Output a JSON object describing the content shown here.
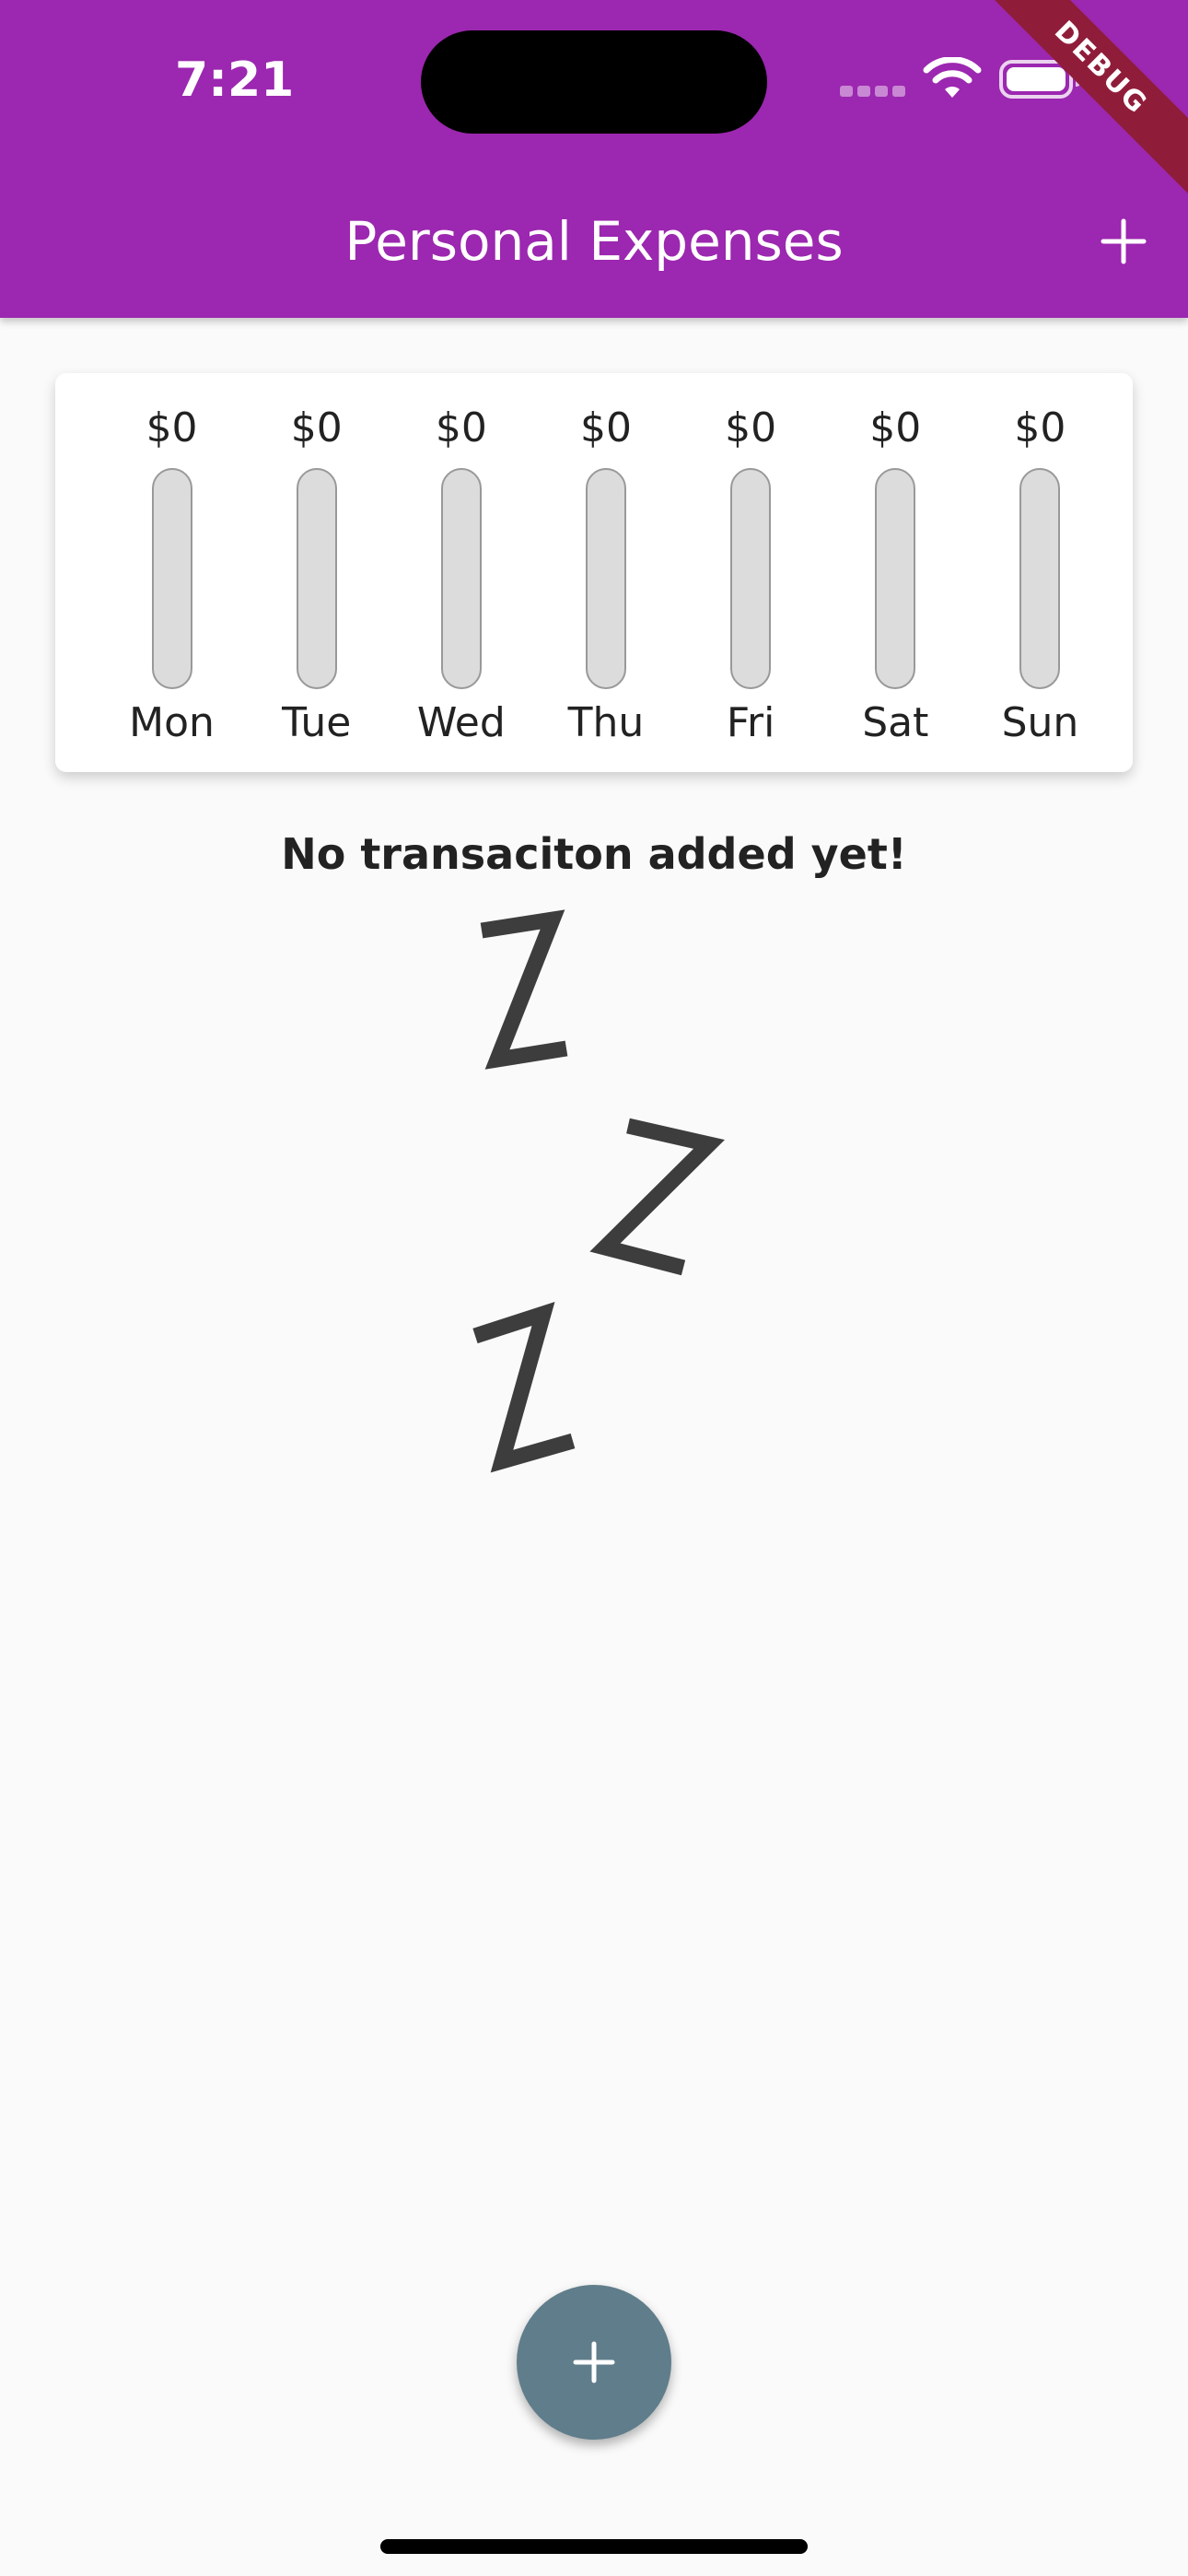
{
  "status_bar": {
    "time": "7:21"
  },
  "debug_banner": "DEBUG",
  "app_bar": {
    "title": "Personal Expenses",
    "add_icon": "plus-icon"
  },
  "chart": {
    "days": [
      {
        "day": "Mon",
        "amount": "$0",
        "fill": 0
      },
      {
        "day": "Tue",
        "amount": "$0",
        "fill": 0
      },
      {
        "day": "Wed",
        "amount": "$0",
        "fill": 0
      },
      {
        "day": "Thu",
        "amount": "$0",
        "fill": 0
      },
      {
        "day": "Fri",
        "amount": "$0",
        "fill": 0
      },
      {
        "day": "Sat",
        "amount": "$0",
        "fill": 0
      },
      {
        "day": "Sun",
        "amount": "$0",
        "fill": 0
      }
    ]
  },
  "empty_state": {
    "text": "No transaciton added yet!",
    "image": "sleeping-zzz-icon"
  },
  "fab": {
    "icon": "plus-icon"
  },
  "colors": {
    "primary": "#9c27b0",
    "fab": "#607d8b",
    "bar_empty": "#dcdcdc"
  }
}
